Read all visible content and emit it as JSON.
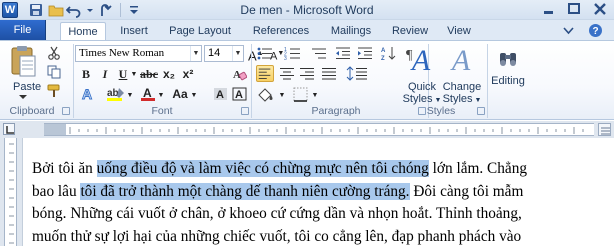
{
  "window": {
    "title": "De men - Microsoft Word",
    "app_logo_letter": "W"
  },
  "quick_access": [
    {
      "icon": "save-icon"
    },
    {
      "icon": "open-folder-icon"
    },
    {
      "icon": "undo-icon"
    },
    {
      "icon": "redo-icon"
    }
  ],
  "tabs": {
    "file": "File",
    "items": [
      "Home",
      "Insert",
      "Page Layout",
      "References",
      "Mailings",
      "Review",
      "View"
    ],
    "active": "Home"
  },
  "ribbon": {
    "clipboard": {
      "label": "Clipboard",
      "paste_label": "Paste"
    },
    "font": {
      "label": "Font",
      "font_name": "Times New Roman",
      "font_size": "14",
      "bold": "B",
      "italic": "I",
      "underline": "U",
      "subscript": "x₂",
      "superscript": "x²",
      "grow": "A",
      "shrink": "A",
      "case": "Aa",
      "font_color_letter": "A",
      "highlight_letters": "ab"
    },
    "paragraph": {
      "label": "Paragraph"
    },
    "styles": {
      "label": "Styles",
      "quick_styles_1": "Quick",
      "quick_styles_2": "Styles",
      "change_styles_1": "Change",
      "change_styles_2": "Styles"
    },
    "editing": {
      "label": "Editing"
    }
  },
  "document": {
    "lines": [
      {
        "before": "Bởi tôi ăn ",
        "highlight": "uống điều độ và làm việc có chừng mực nên tôi chóng",
        "after": " lớn lắm. Chẳng"
      },
      {
        "before": "bao lâu ",
        "highlight": "tôi đã trở thành một chàng dế thanh niên cường tráng.",
        "after": " Đôi càng tôi mẫm"
      },
      {
        "before": "bóng. Những cái vuốt ở chân, ở khoeo cứ cứng dần và nhọn hoắt. Thỉnh thoảng,",
        "highlight": "",
        "after": ""
      },
      {
        "before": "muốn thử sự lợi hại của những chiếc vuốt, tôi co cẳng lên, đạp phanh phách vào",
        "highlight": "",
        "after": ""
      }
    ]
  },
  "colors": {
    "selection": "#a8c8ec",
    "file_tab": "#2a62c0",
    "font_color_bar": "#d22b2b",
    "highlight_bar": "#ffff00"
  }
}
